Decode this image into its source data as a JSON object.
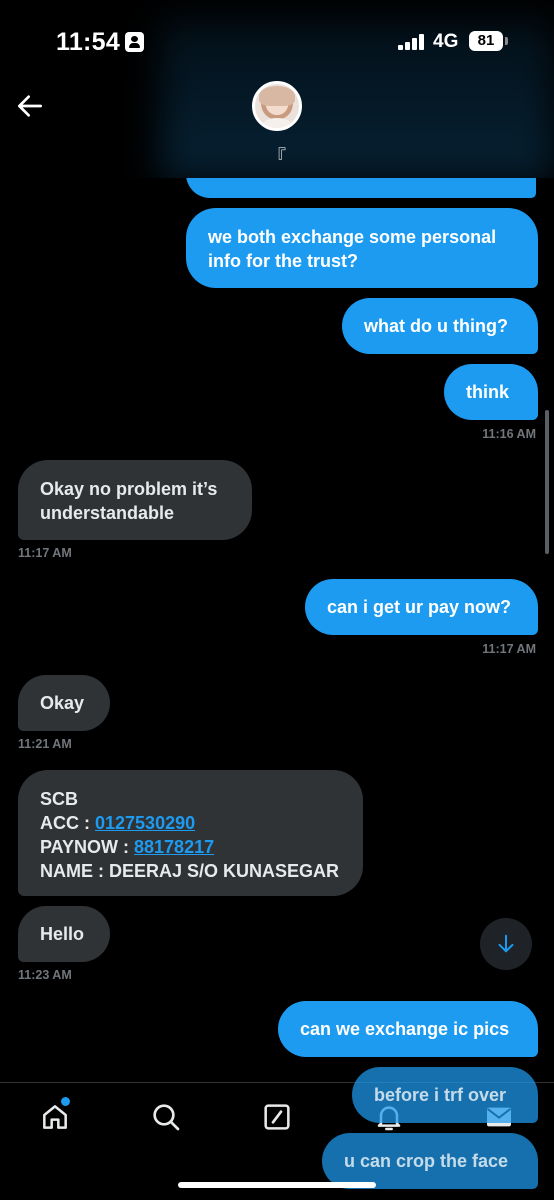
{
  "status_bar": {
    "time": "11:54",
    "network": "4G",
    "battery": "81"
  },
  "header": {
    "display_name": "『"
  },
  "messages": {
    "m1": {
      "text": "we both exchange some personal info for the trust?",
      "line1": "we both exchange some personal",
      "line2": "info for the trust?"
    },
    "m2": {
      "text": "what do u thing?"
    },
    "m3": {
      "text": "think",
      "time": "11:16 AM"
    },
    "m4": {
      "line1": "Okay no problem it’s",
      "line2": "understandable",
      "time": "11:17 AM"
    },
    "m5": {
      "text": "can i get ur pay now?",
      "time": "11:17 AM"
    },
    "m6": {
      "text": "Okay",
      "time": "11:21 AM"
    },
    "m7": {
      "bank": "SCB",
      "acc_label": "ACC : ",
      "acc_number": "0127530290",
      "paynow_label": "PAYNOW : ",
      "paynow_number": "88178217",
      "name_line": "NAME : DEERAJ S/O KUNASEGAR"
    },
    "m8": {
      "text": "Hello",
      "time": "11:23 AM"
    },
    "m9": {
      "text": "can we exchange ic pics"
    },
    "m10": {
      "text": "before i trf over"
    },
    "m11": {
      "text": "u can crop the face"
    }
  },
  "nav": {
    "items": [
      "home-icon",
      "search-icon",
      "compose-icon",
      "notifications-icon",
      "messages-icon"
    ],
    "home_has_badge": true
  },
  "colors": {
    "accent": "#1d9bf0",
    "incoming_bubble": "#2f3336",
    "background": "#000000",
    "timestamp": "#71767b"
  }
}
